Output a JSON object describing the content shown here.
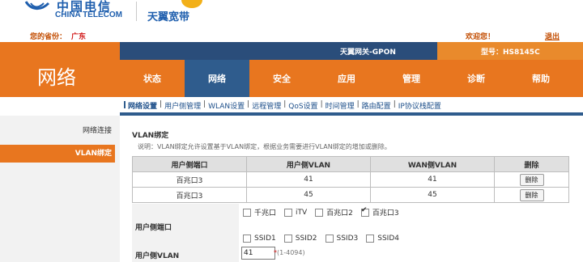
{
  "brand": {
    "logo_cn": "中国电信",
    "logo_en": "CHINA TELECOM",
    "product": "天翼宽带"
  },
  "header": {
    "province_label": "您的省份：",
    "province_value": "广东",
    "welcome": "欢迎您！",
    "logout": "退出"
  },
  "device": {
    "name": "天翼网关-GPON",
    "model": "型号：HS8145C"
  },
  "page_title": "网络",
  "nav": [
    {
      "label": "状态",
      "active": false
    },
    {
      "label": "网络",
      "active": true
    },
    {
      "label": "安全",
      "active": false
    },
    {
      "label": "应用",
      "active": false
    },
    {
      "label": "管理",
      "active": false
    },
    {
      "label": "诊断",
      "active": false
    },
    {
      "label": "帮助",
      "active": false
    }
  ],
  "subnav": [
    {
      "label": "网络设置",
      "active": true
    },
    {
      "label": "用户侧管理",
      "active": false
    },
    {
      "label": "WLAN设置",
      "active": false
    },
    {
      "label": "远程管理",
      "active": false
    },
    {
      "label": "QoS设置",
      "active": false
    },
    {
      "label": "时间管理",
      "active": false
    },
    {
      "label": "路由配置",
      "active": false
    },
    {
      "label": "IP协议栈配置",
      "active": false
    }
  ],
  "side_menu": [
    {
      "label": "网络连接",
      "active": false
    },
    {
      "label": "VLAN绑定",
      "active": true
    }
  ],
  "section": {
    "title": "VLAN绑定",
    "description": "说明：VLAN绑定允许设置基于VLAN绑定，根据业务需要进行VLAN绑定的增加或删除。"
  },
  "table": {
    "headers": [
      "用户侧端口",
      "用户侧VLAN",
      "WAN侧VLAN",
      "删除"
    ],
    "rows": [
      {
        "port": "百兆口3",
        "user_vlan": "41",
        "wan_vlan": "41",
        "delete": "删除"
      },
      {
        "port": "百兆口3",
        "user_vlan": "45",
        "wan_vlan": "45",
        "delete": "删除"
      }
    ]
  },
  "form": {
    "port_label": "用户侧端口",
    "vlan_label": "用户侧VLAN",
    "ports_row1": [
      {
        "label": "千兆口",
        "checked": false
      },
      {
        "label": "iTV",
        "checked": false
      },
      {
        "label": "百兆口2",
        "checked": false
      },
      {
        "label": "百兆口3",
        "checked": true
      }
    ],
    "ports_row2": [
      {
        "label": "SSID1",
        "checked": false
      },
      {
        "label": "SSID2",
        "checked": false
      },
      {
        "label": "SSID3",
        "checked": false
      },
      {
        "label": "SSID4",
        "checked": false
      }
    ],
    "vlan_value": "41",
    "vlan_required_mark": "*",
    "vlan_hint": "(1-4094)"
  },
  "colors": {
    "orange": "#e8761f",
    "blue": "#2f5c8d",
    "dark_blue": "#2a4d7a"
  }
}
